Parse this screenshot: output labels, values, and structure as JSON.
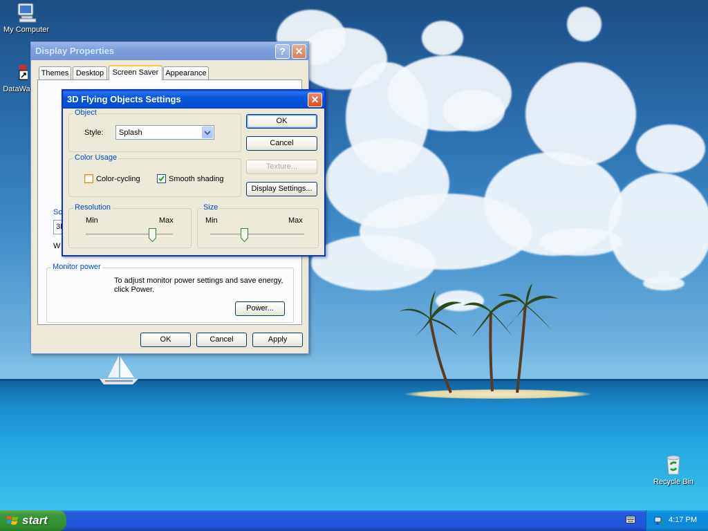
{
  "desktop": {
    "icons": [
      {
        "label": "My Computer",
        "icon": "my-computer-icon"
      },
      {
        "label": "DataWa",
        "icon": "shortcut-icon"
      },
      {
        "label": "Recycle Bin",
        "icon": "recycle-bin-icon"
      }
    ]
  },
  "display_properties": {
    "title": "Display Properties",
    "tabs": [
      "Themes",
      "Desktop",
      "Screen Saver",
      "Appearance"
    ],
    "selected_tab": "Screen Saver",
    "screen_saver_group_label_fragment": "Sc",
    "screen_saver_select_fragment": "3D",
    "wait_fragment": "W",
    "monitor_power": {
      "label": "Monitor power",
      "text": "To adjust monitor power settings and save energy, click Power.",
      "power_button": "Power..."
    },
    "buttons": {
      "ok": "OK",
      "cancel": "Cancel",
      "apply": "Apply"
    }
  },
  "flying_objects_settings": {
    "title": "3D Flying Objects Settings",
    "object_group": {
      "label": "Object",
      "style_label": "Style:",
      "style_value": "Splash"
    },
    "color_usage_group": {
      "label": "Color Usage",
      "color_cycling": {
        "label": "Color-cycling",
        "checked": false
      },
      "smooth_shading": {
        "label": "Smooth shading",
        "checked": true
      }
    },
    "resolution_group": {
      "label": "Resolution",
      "min": "Min",
      "max": "Max",
      "level": 0.76
    },
    "size_group": {
      "label": "Size",
      "min": "Min",
      "max": "Max",
      "level": 0.36
    },
    "buttons": {
      "ok": "OK",
      "cancel": "Cancel",
      "texture": "Texture...",
      "display_settings": "Display Settings..."
    }
  },
  "taskbar": {
    "start_label": "start",
    "clock": "4:17 PM"
  },
  "colors": {
    "title_active": "#0855dd",
    "group_label": "#0046d5",
    "start_green": "#3c9a3a",
    "taskbar_blue": "#245edc"
  }
}
